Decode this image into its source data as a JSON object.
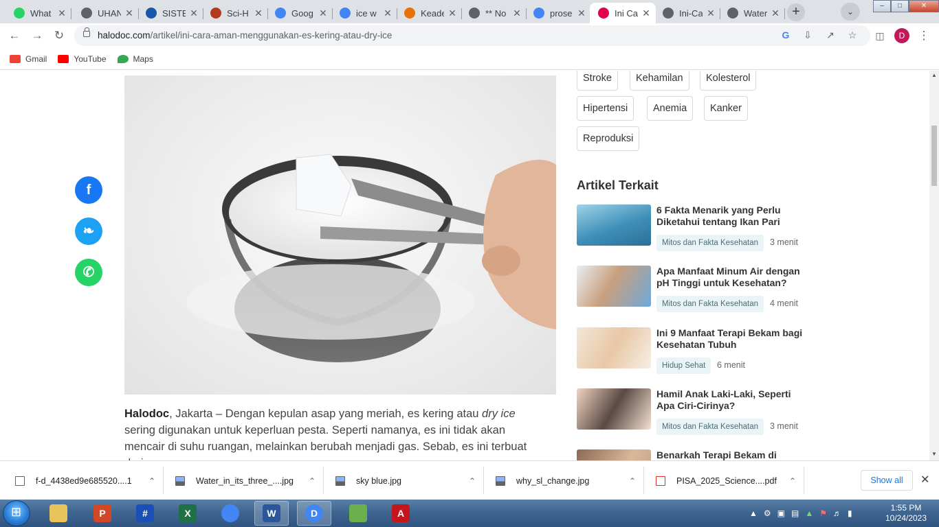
{
  "browser": {
    "tabs": [
      {
        "label": "What",
        "icon": "whatsapp-icon",
        "color": "#25d366"
      },
      {
        "label": "UHAN",
        "icon": "globe-icon",
        "color": "#5f6368"
      },
      {
        "label": "SISTE",
        "icon": "kemdikbud-icon",
        "color": "#1a56a8"
      },
      {
        "label": "Sci-H",
        "icon": "scihub-icon",
        "color": "#b23a1f"
      },
      {
        "label": "Goog",
        "icon": "google-translate-icon",
        "color": "#4285f4"
      },
      {
        "label": "ice w",
        "icon": "google-icon",
        "color": "#4285f4"
      },
      {
        "label": "Keade",
        "icon": "scribd-icon",
        "color": "#e8710a"
      },
      {
        "label": "** No",
        "icon": "globe-icon",
        "color": "#5f6368"
      },
      {
        "label": "prose",
        "icon": "google-icon",
        "color": "#4285f4"
      },
      {
        "label": "Ini Ca",
        "icon": "halodoc-icon",
        "color": "#e0004d"
      },
      {
        "label": "Ini-Ca",
        "icon": "globe-icon",
        "color": "#5f6368"
      },
      {
        "label": "Water",
        "icon": "globe-icon",
        "color": "#5f6368"
      }
    ],
    "active_tab": 9,
    "url_domain": "halodoc.com",
    "url_path": "/artikel/ini-cara-aman-menggunakan-es-kering-atau-dry-ice",
    "profile_initial": "D",
    "bookmarks": [
      {
        "label": "Gmail",
        "icon": "gmail-icon"
      },
      {
        "label": "YouTube",
        "icon": "youtube-icon"
      },
      {
        "label": "Maps",
        "icon": "maps-icon"
      }
    ]
  },
  "page": {
    "tags": [
      "Stroke",
      "Kehamilan",
      "Kolesterol",
      "Hipertensi",
      "Anemia",
      "Kanker",
      "Reproduksi"
    ],
    "share_buttons": [
      {
        "name": "facebook",
        "glyph": "f",
        "color": "#1877f2"
      },
      {
        "name": "twitter",
        "glyph": "❧",
        "color": "#1da1f2"
      },
      {
        "name": "whatsapp",
        "glyph": "✆",
        "color": "#25d366"
      }
    ],
    "article": {
      "source": "Halodoc",
      "para_lead": ", Jakarta – Dengan kepulan asap yang meriah, es kering atau ",
      "para_italic": "dry ice",
      "para_rest": " sering digunakan untuk keperluan pesta. Seperti namanya, es ini tidak akan mencair di suhu ruangan, melainkan berubah menjadi gas. Sebab, es ini terbuat dari ..."
    },
    "related_heading": "Artikel Terkait",
    "related": [
      {
        "title": "6 Fakta Menarik yang Perlu Diketahui tentang Ikan Pari",
        "category": "Mitos dan Fakta Kesehatan",
        "time": "3 menit",
        "thumb": "stingray"
      },
      {
        "title": "Apa Manfaat Minum Air dengan pH Tinggi untuk Kesehatan?",
        "category": "Mitos dan Fakta Kesehatan",
        "time": "4 menit",
        "thumb": "drinking"
      },
      {
        "title": "Ini 9 Manfaat Terapi Bekam bagi Kesehatan Tubuh",
        "category": "Hidup Sehat",
        "time": "6 menit",
        "thumb": "massage"
      },
      {
        "title": "Hamil Anak Laki-Laki, Seperti Apa Ciri-Cirinya?",
        "category": "Mitos dan Fakta Kesehatan",
        "time": "3 menit",
        "thumb": "ultrasound"
      },
      {
        "title": "Benarkah Terapi Bekam di",
        "category": "",
        "time": "",
        "thumb": "cupping"
      }
    ]
  },
  "downloads": {
    "items": [
      {
        "name": "f-d_4438ed9e685520....1",
        "type": "file"
      },
      {
        "name": "Water_in_its_three_....jpg",
        "type": "image"
      },
      {
        "name": "sky blue.jpg",
        "type": "image"
      },
      {
        "name": "why_sl_change.jpg",
        "type": "image"
      },
      {
        "name": "PISA_2025_Science....pdf",
        "type": "pdf"
      }
    ],
    "show_all": "Show all"
  },
  "taskbar": {
    "apps": [
      {
        "name": "explorer",
        "label": "",
        "color": "#e8c25a"
      },
      {
        "name": "powerpoint",
        "label": "P",
        "color": "#d24726"
      },
      {
        "name": "hash-app",
        "label": "#",
        "color": "#1b4fb8"
      },
      {
        "name": "excel",
        "label": "X",
        "color": "#1e7145"
      },
      {
        "name": "chrome",
        "label": "",
        "color": "#4285f4"
      },
      {
        "name": "word",
        "label": "W",
        "color": "#2b579a"
      },
      {
        "name": "chrome-profile",
        "label": "D",
        "color": "#4285f4"
      },
      {
        "name": "leaf-app",
        "label": "",
        "color": "#6ab04c"
      },
      {
        "name": "acrobat",
        "label": "A",
        "color": "#c4161c"
      }
    ],
    "time": "1:55 PM",
    "date": "10/24/2023"
  }
}
